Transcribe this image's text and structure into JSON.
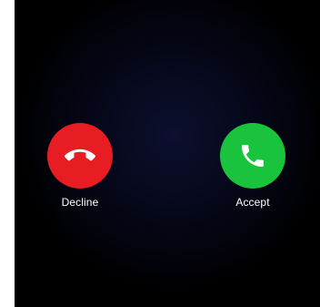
{
  "call": {
    "decline_label": "Decline",
    "accept_label": "Accept"
  },
  "icons": {
    "decline": "phone-hangup-icon",
    "accept": "phone-answer-icon"
  },
  "colors": {
    "decline": "#e81d23",
    "accept": "#19c43c",
    "background": "#000000",
    "label": "#ffffff"
  }
}
